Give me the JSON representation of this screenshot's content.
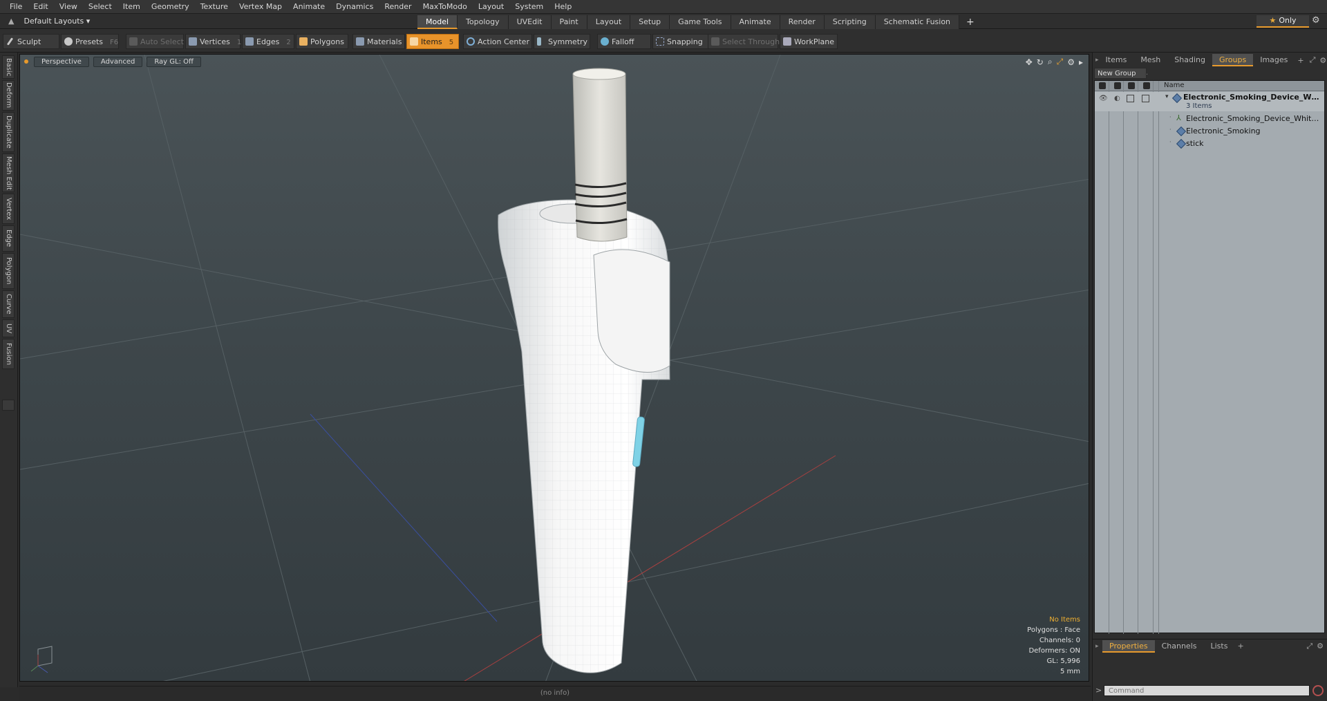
{
  "menu": [
    "File",
    "Edit",
    "View",
    "Select",
    "Item",
    "Geometry",
    "Texture",
    "Vertex Map",
    "Animate",
    "Dynamics",
    "Render",
    "MaxToModo",
    "Layout",
    "System",
    "Help"
  ],
  "layout_selector": "Default Layouts ▾",
  "tabs": [
    {
      "label": "Model",
      "active": true
    },
    {
      "label": "Topology"
    },
    {
      "label": "UVEdit"
    },
    {
      "label": "Paint"
    },
    {
      "label": "Layout"
    },
    {
      "label": "Setup"
    },
    {
      "label": "Game Tools"
    },
    {
      "label": "Animate"
    },
    {
      "label": "Render"
    },
    {
      "label": "Scripting"
    },
    {
      "label": "Schematic Fusion"
    }
  ],
  "tab_add": "+",
  "only_label": "Only",
  "toolbar": {
    "sculpt": "Sculpt",
    "presets": "Presets",
    "presets_key": "F6",
    "auto_select": "Auto Select",
    "vertices": "Vertices",
    "vertices_key": "1",
    "edges": "Edges",
    "edges_key": "2",
    "polygons": "Polygons",
    "materials": "Materials",
    "items": "Items",
    "items_key": "5",
    "action_center": "Action Center",
    "symmetry": "Symmetry",
    "falloff": "Falloff",
    "snapping": "Snapping",
    "select_through": "Select Through",
    "workplane": "WorkPlane"
  },
  "left_tabs": [
    "Basic",
    "Deform",
    "Duplicate",
    "Mesh Edit",
    "Vertex",
    "Edge",
    "Polygon",
    "Curve",
    "UV",
    "Fusion"
  ],
  "viewport": {
    "view": "Perspective",
    "shading": "Advanced",
    "raygl": "Ray GL: Off"
  },
  "info": {
    "items": "No Items",
    "polygons": "Polygons : Face",
    "channels": "Channels: 0",
    "deformers": "Deformers: ON",
    "gl": "GL: 5,996",
    "unit": "5 mm"
  },
  "status": "(no info)",
  "right_tabs": [
    {
      "label": "Items"
    },
    {
      "label": "Mesh ..."
    },
    {
      "label": "Shading"
    },
    {
      "label": "Groups",
      "active": true
    },
    {
      "label": "Images"
    }
  ],
  "new_group": "New Group",
  "list_header": "Name",
  "groups": {
    "root": "Electronic_Smoking_Device_Wh...",
    "root_count": "3 Items",
    "children": [
      "Electronic_Smoking_Device_White_...",
      "Electronic_Smoking",
      "stick"
    ]
  },
  "bottom_tabs": [
    {
      "label": "Properties",
      "active": true
    },
    {
      "label": "Channels"
    },
    {
      "label": "Lists"
    }
  ],
  "command_placeholder": "Command",
  "colors": {
    "accent": "#e89a2c",
    "viewport_bg": "#3e474b",
    "list_bg": "#a4abb0"
  }
}
